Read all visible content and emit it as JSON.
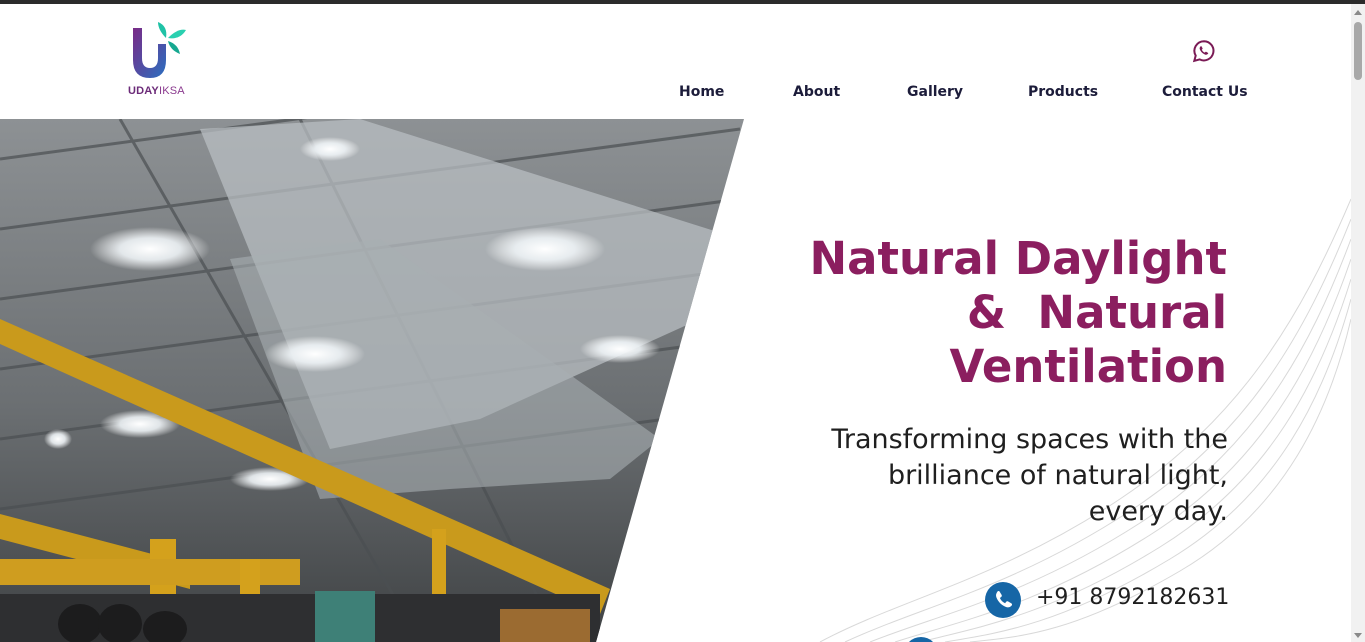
{
  "brand": {
    "name_bold": "UDAY",
    "name_light": "IKSA",
    "colors": {
      "primary": "#8b1e5f",
      "leaf": "#1fc2a6",
      "nav": "#1c1c3a",
      "accent": "#1666a6"
    }
  },
  "header": {
    "whatsapp_icon": "whatsapp-icon",
    "nav": [
      "Home",
      "About",
      "Gallery",
      "Products",
      "Contact Us"
    ]
  },
  "hero": {
    "title_lines": [
      "Natural Daylight",
      "&  Natural",
      "Ventilation"
    ],
    "subtitle_lines": [
      "Transforming spaces with the",
      "brilliance of natural light,",
      "every day."
    ],
    "phone_icon": "phone-icon",
    "phone": "+91 8792182631",
    "image": "factory-ceiling-skylights-photo"
  }
}
